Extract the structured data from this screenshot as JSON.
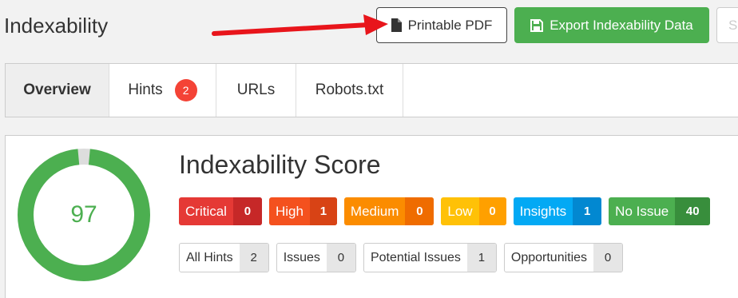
{
  "header": {
    "title": "Indexability",
    "printable_pdf_label": "Printable PDF",
    "export_label": "Export Indexability Data",
    "partial_button_label": "S"
  },
  "tabs": [
    {
      "label": "Overview",
      "active": true
    },
    {
      "label": "Hints",
      "badge": "2"
    },
    {
      "label": "URLs"
    },
    {
      "label": "Robots.txt"
    }
  ],
  "score": {
    "title": "Indexability Score",
    "value": "97",
    "percent": 97,
    "ring_color": "#4caf50",
    "track_color": "#dddddd"
  },
  "severity": [
    {
      "label": "Critical",
      "count": "0",
      "color": "#e53935",
      "count_color": "#c62828"
    },
    {
      "label": "High",
      "count": "1",
      "color": "#f4511e",
      "count_color": "#d84315"
    },
    {
      "label": "Medium",
      "count": "0",
      "color": "#fb8c00",
      "count_color": "#ef6c00"
    },
    {
      "label": "Low",
      "count": "0",
      "color": "#ffc107",
      "count_color": "#ffa000"
    },
    {
      "label": "Insights",
      "count": "1",
      "color": "#03a9f4",
      "count_color": "#0288d1"
    },
    {
      "label": "No Issue",
      "count": "40",
      "color": "#4caf50",
      "count_color": "#388e3c"
    }
  ],
  "filters": [
    {
      "label": "All Hints",
      "count": "2"
    },
    {
      "label": "Issues",
      "count": "0"
    },
    {
      "label": "Potential Issues",
      "count": "1"
    },
    {
      "label": "Opportunities",
      "count": "0"
    }
  ],
  "icons": {
    "pdf": "document-icon",
    "export": "floppy-disk-icon",
    "annotation": "red-arrow"
  }
}
